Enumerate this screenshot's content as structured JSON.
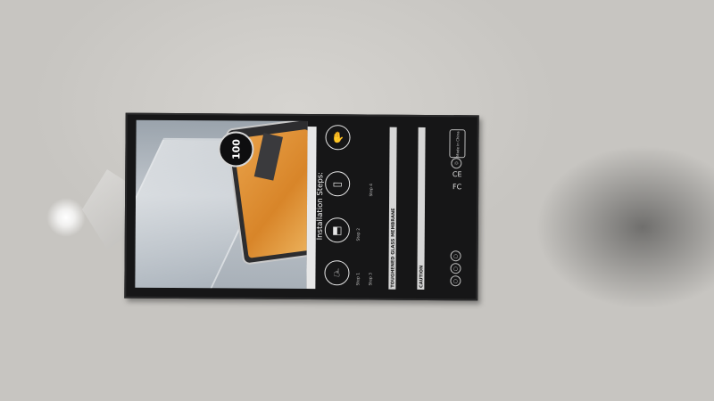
{
  "package": {
    "badge": "100",
    "install_title": "Installation Steps:",
    "steps": [
      {
        "label": "Step 1",
        "icon": "wipe-icon"
      },
      {
        "label": "Step 2",
        "icon": "dust-removal-icon"
      },
      {
        "label": "Step 3",
        "icon": "apply-glass-icon"
      },
      {
        "label": "Step 4",
        "icon": "press-bubbles-icon"
      }
    ],
    "warning_label": "TOUGHENED GLASS MEMBRANE",
    "caution_label": "CAUTION",
    "made_in": "Made in China",
    "certifications": [
      "FC",
      "CE"
    ]
  }
}
